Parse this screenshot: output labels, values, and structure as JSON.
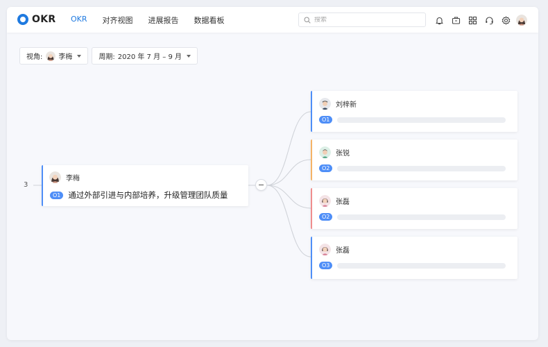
{
  "colors": {
    "brand": "#1f7ae0",
    "card_accent_blue": "#4e8ef7",
    "card_accent_orange": "#f5b366",
    "card_accent_red": "#ef8d8d",
    "badge": "#4e8ef7"
  },
  "header": {
    "app_name": "OKR",
    "nav": [
      {
        "label": "OKR",
        "active": true
      },
      {
        "label": "对齐视图",
        "active": false
      },
      {
        "label": "进展报告",
        "active": false
      },
      {
        "label": "数据看板",
        "active": false
      }
    ],
    "search": {
      "placeholder": "搜索",
      "value": "",
      "icon": "search-icon"
    },
    "tools": [
      "bell-icon",
      "briefcase-icon",
      "apps-grid-icon",
      "headset-icon",
      "gear-icon"
    ],
    "user_avatar": "avatar-woman"
  },
  "filters": {
    "view": {
      "label": "视角:",
      "user": "李梅"
    },
    "period": {
      "label": "周期:",
      "value": "2020 年 7 月 – 9 月"
    }
  },
  "mindmap": {
    "count": "3",
    "root": {
      "owner": "李梅",
      "badge": "O1",
      "title": "通过外部引进与内部培养，升级管理团队质量"
    },
    "children": [
      {
        "owner": "刘梓新",
        "badge": "O1",
        "accent": "#4e8ef7",
        "avatar": "man"
      },
      {
        "owner": "张锐",
        "badge": "O2",
        "accent": "#f5b366",
        "avatar": "man-green"
      },
      {
        "owner": "张磊",
        "badge": "O2",
        "accent": "#ef8d8d",
        "avatar": "woman-pink"
      },
      {
        "owner": "张磊",
        "badge": "O3",
        "accent": "#4e8ef7",
        "avatar": "woman-pink"
      }
    ]
  }
}
